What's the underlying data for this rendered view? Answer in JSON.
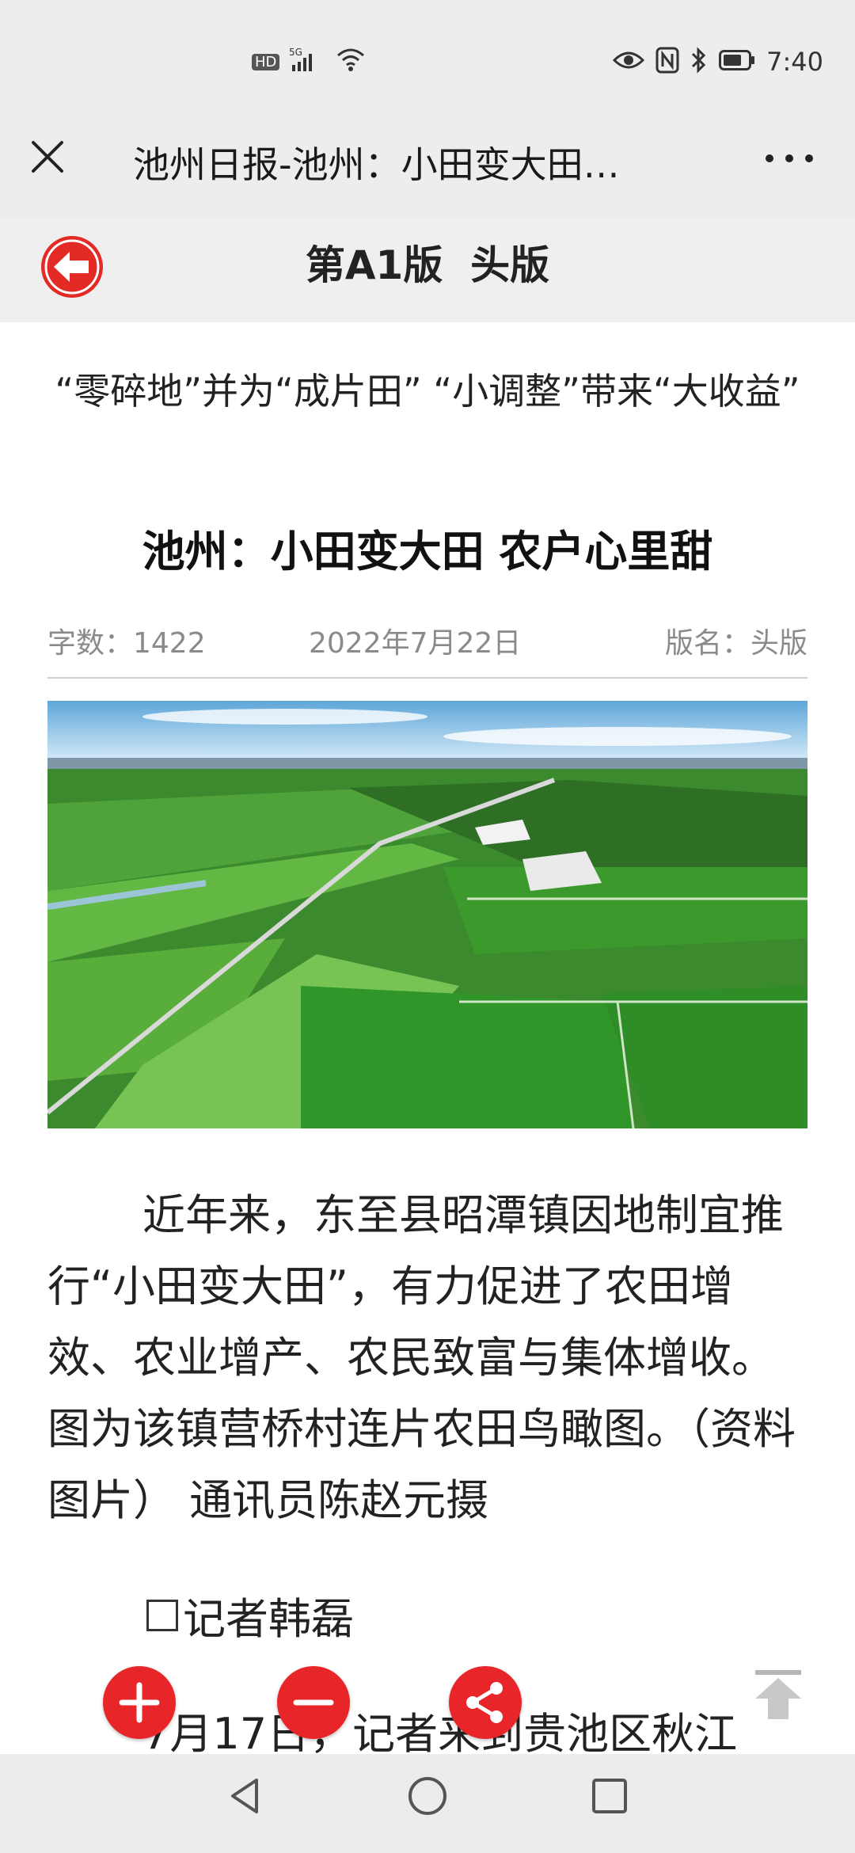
{
  "status_bar": {
    "network_badges": [
      "HD",
      "5G"
    ],
    "time": "7:40"
  },
  "title_bar": {
    "title": "池州日报-池州：小田变大田…",
    "close_icon": "close-icon",
    "more_icon": "more-icon"
  },
  "page_header": {
    "edition": "第A1版  头版",
    "back_icon": "back-arrow-icon"
  },
  "article": {
    "subtitle": "“零碎地”并为“成片田” “小调整”带来“大收益”",
    "headline": "池州：小田变大田 农户心里甜",
    "meta": {
      "word_count": "字数：1422",
      "date": "2022年7月22日",
      "section": "版名：头版"
    },
    "photo_alt": "aerial-farmland-photo",
    "caption": "近年来，东至县昭潭镇因地制宜推行“小田变大田”，有力促进了农田增效、农业增产、农民致富与集体增收。图为该镇营桥村连片农田鸟瞰图。（资料图片） 通讯员陈赵元摄",
    "byline": "记者韩磊",
    "body_start": "7月17日，记者来到贵池区秋江"
  },
  "floating_buttons": {
    "zoom_in": "plus-icon",
    "zoom_out": "minus-icon",
    "share": "share-icon",
    "to_top": "scroll-to-top-icon"
  },
  "nav_bar": {
    "back": "nav-back-icon",
    "home": "nav-home-icon",
    "recent": "nav-recent-icon"
  },
  "colors": {
    "accent_red": "#e32a25",
    "bar_gray": "#ededed"
  }
}
